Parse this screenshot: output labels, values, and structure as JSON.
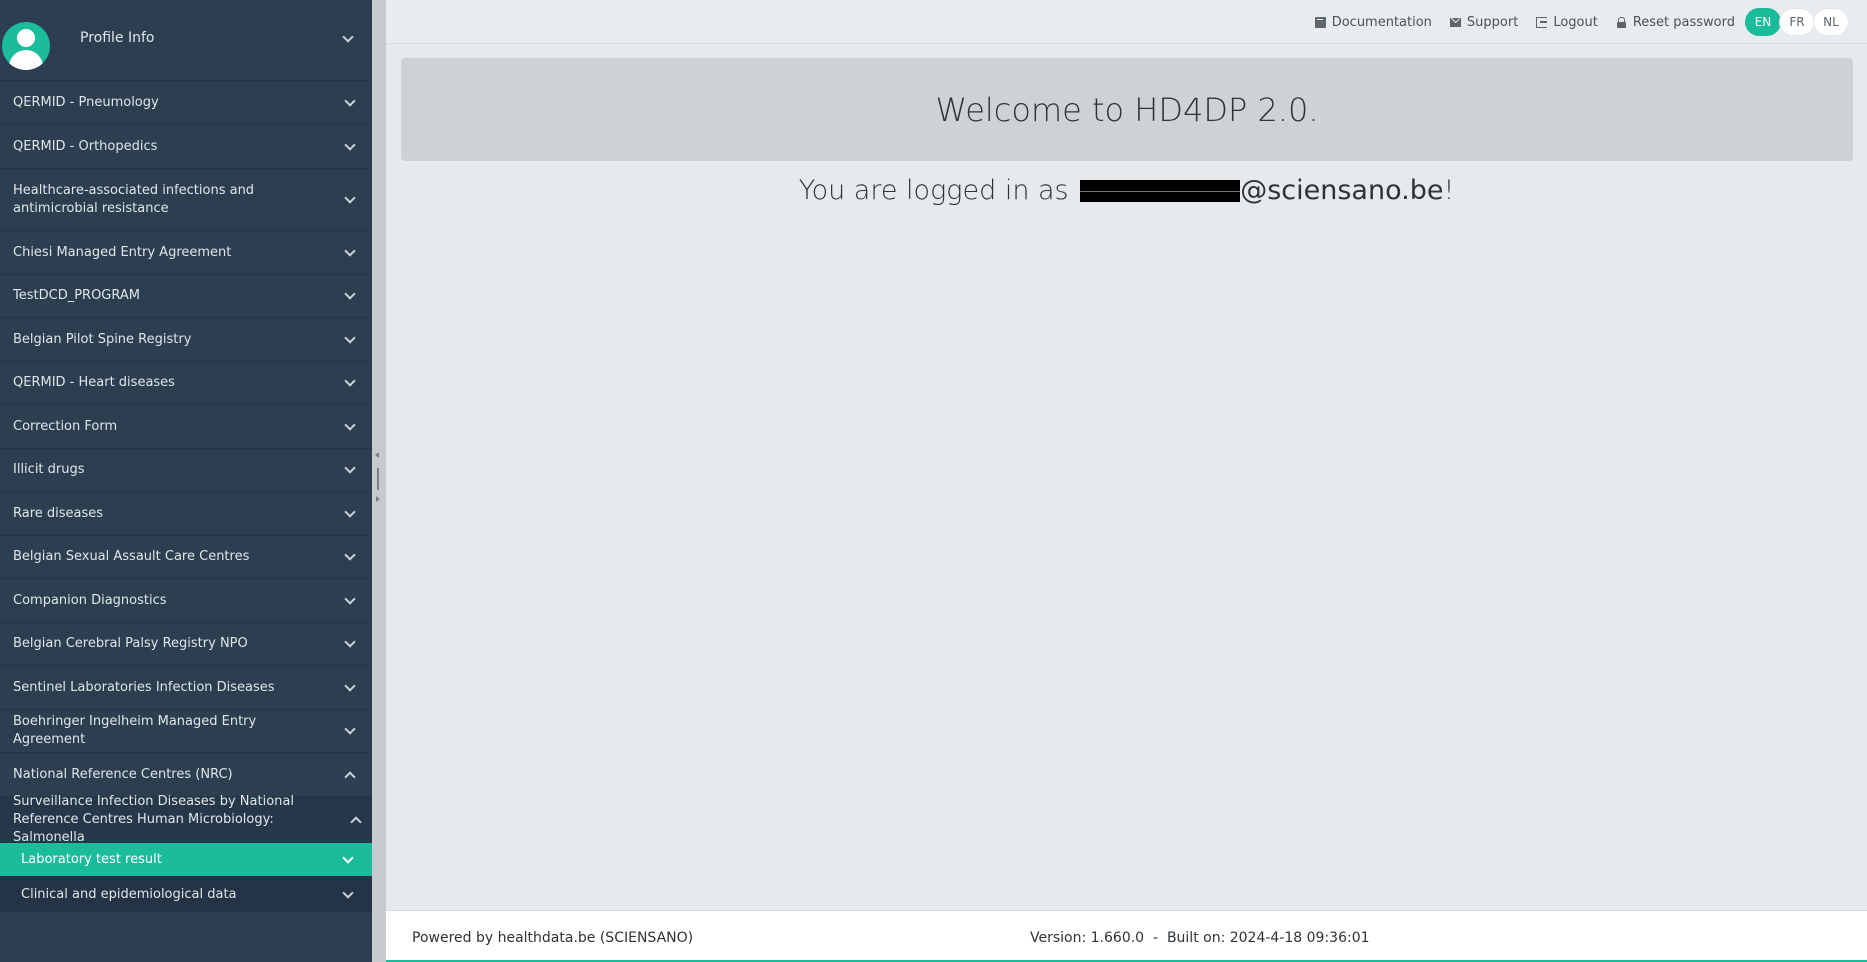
{
  "sidebar": {
    "profile_label": "Profile Info",
    "items": [
      {
        "label": "QERMID - Pneumology"
      },
      {
        "label": "QERMID - Orthopedics"
      },
      {
        "label": "Healthcare-associated infections and antimicrobial resistance"
      },
      {
        "label": "Chiesi Managed Entry Agreement"
      },
      {
        "label": "TestDCD_PROGRAM"
      },
      {
        "label": "Belgian Pilot Spine Registry"
      },
      {
        "label": "QERMID - Heart diseases"
      },
      {
        "label": "Correction Form"
      },
      {
        "label": "Illicit drugs"
      },
      {
        "label": "Rare diseases"
      },
      {
        "label": "Belgian Sexual Assault Care Centres"
      },
      {
        "label": "Companion Diagnostics"
      },
      {
        "label": "Belgian Cerebral Palsy Registry NPO"
      },
      {
        "label": "Sentinel Laboratories Infection Diseases"
      },
      {
        "label": "Boehringer Ingelheim Managed Entry Agreement"
      },
      {
        "label": "National Reference Centres (NRC)"
      },
      {
        "label": "Surveillance Infection Diseases by National Reference Centres Human Microbiology: Salmonella"
      },
      {
        "label": "Laboratory test result"
      },
      {
        "label": "Clinical and epidemiological data"
      }
    ]
  },
  "topbar": {
    "documentation": "Documentation",
    "support": "Support",
    "logout": "Logout",
    "reset_password": "Reset password",
    "languages": [
      "EN",
      "FR",
      "NL"
    ],
    "active_language": "EN"
  },
  "main": {
    "welcome": "Welcome to HD4DP 2.0.",
    "logged_prefix": "You are logged in as ",
    "email_domain": "@sciensano.be",
    "logged_suffix": "!"
  },
  "footer": {
    "powered": "Powered by healthdata.be (SCIENSANO)",
    "version": "Version: 1.660.0  -  Built on: 2024-4-18 09:36:01"
  },
  "colors": {
    "sidebar": "#2c3e50",
    "accent": "#1abc9c",
    "background": "#e6eaed"
  }
}
